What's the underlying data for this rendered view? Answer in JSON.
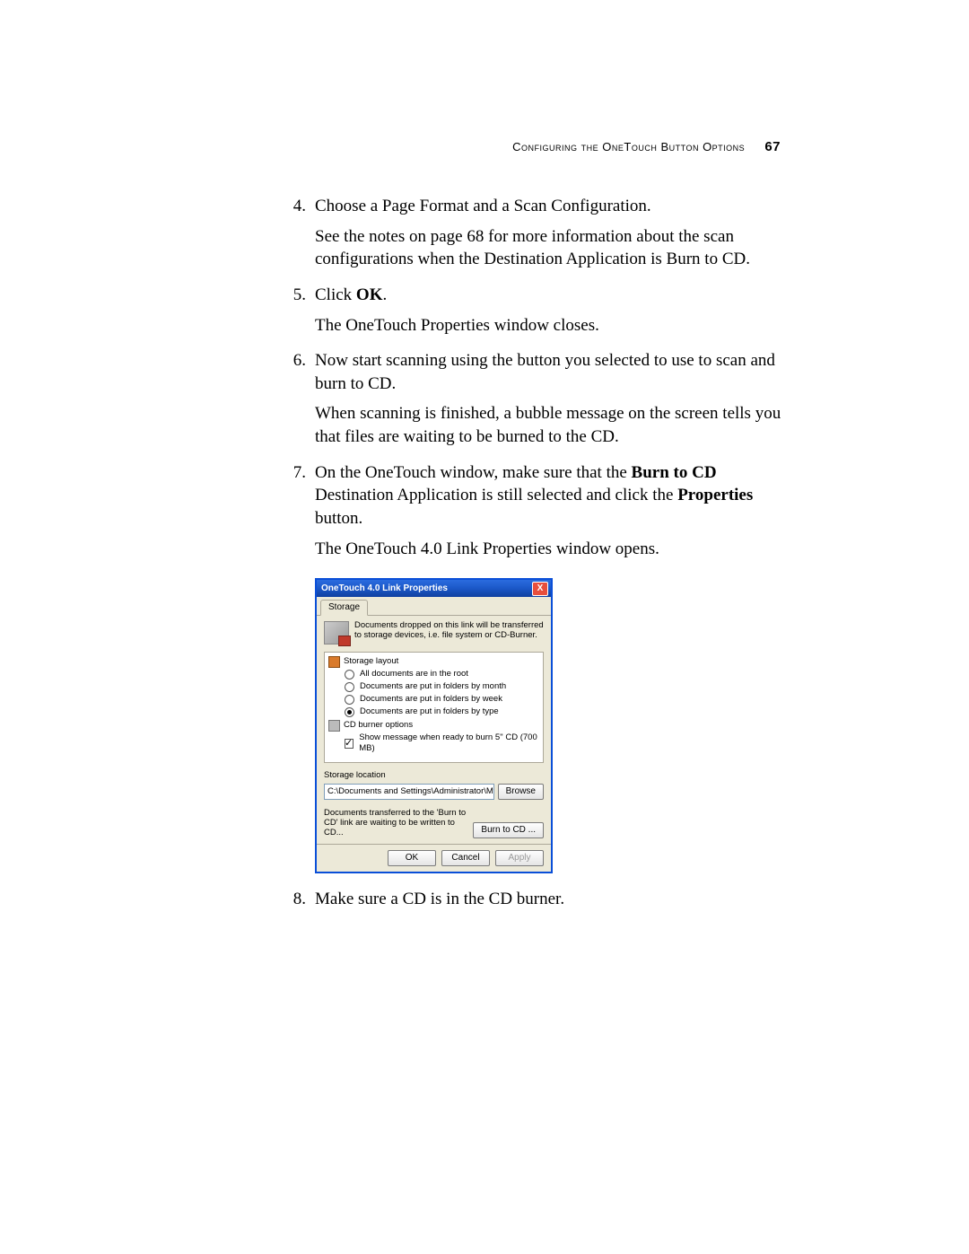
{
  "header": {
    "section_title": "Configuring the OneTouch Button Options",
    "page_number": "67"
  },
  "steps": {
    "s4": {
      "num": "4.",
      "p1": "Choose a Page Format and a Scan Configuration.",
      "p2": "See the notes on page 68 for more information about the scan configurations when the Destination Application is Burn to CD."
    },
    "s5": {
      "num": "5.",
      "p1a": "Click ",
      "p1b": "OK",
      "p1c": ".",
      "p2": "The OneTouch Properties window closes."
    },
    "s6": {
      "num": "6.",
      "p1": "Now start scanning using the button you selected to use to scan and burn to CD.",
      "p2": "When scanning is finished, a bubble message on the screen tells you that files are waiting to be burned to the CD."
    },
    "s7": {
      "num": "7.",
      "p1a": "On the OneTouch window, make sure that the ",
      "p1b": "Burn to CD",
      "p1c": " Destination Application is still selected and click the ",
      "p1d": "Properties",
      "p1e": " button.",
      "p2": "The OneTouch 4.0 Link Properties window opens."
    },
    "s8": {
      "num": "8.",
      "p1": "Make sure a CD is in the CD burner."
    }
  },
  "dialog": {
    "title": "OneTouch 4.0 Link Properties",
    "close": "X",
    "tab": "Storage",
    "description": "Documents dropped on this link will be transferred to storage devices, i.e. file system or CD-Burner.",
    "group1_label": "Storage layout",
    "radio1": "All documents are in the root",
    "radio2": "Documents are put in folders by month",
    "radio3": "Documents are put in folders by week",
    "radio4": "Documents are put in folders by type",
    "group2_label": "CD burner options",
    "check1": "Show message when ready to burn 5'' CD (700 MB)",
    "storage_location_label": "Storage location",
    "storage_path": "C:\\Documents and Settings\\Administrator\\My Do",
    "browse": "Browse",
    "burn_note": "Documents transferred to the 'Burn to CD' link are waiting to be written to CD...",
    "burn_btn": "Burn to CD ...",
    "ok": "OK",
    "cancel": "Cancel",
    "apply": "Apply"
  }
}
